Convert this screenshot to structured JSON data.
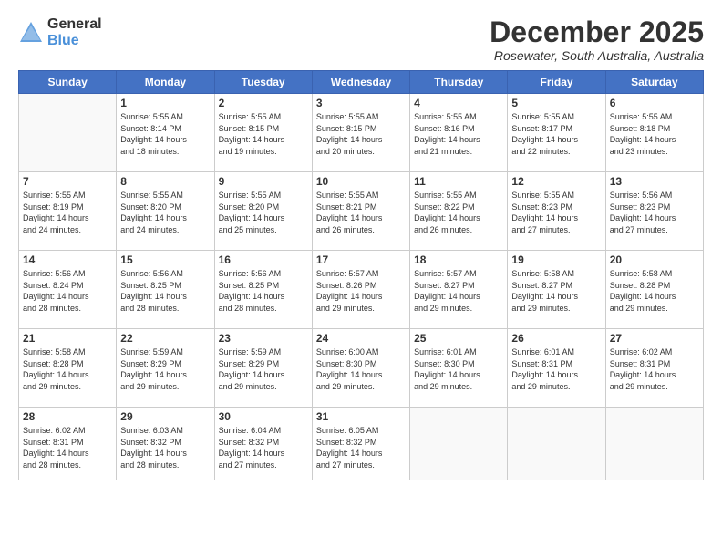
{
  "logo": {
    "general": "General",
    "blue": "Blue"
  },
  "title": "December 2025",
  "location": "Rosewater, South Australia, Australia",
  "days_of_week": [
    "Sunday",
    "Monday",
    "Tuesday",
    "Wednesday",
    "Thursday",
    "Friday",
    "Saturday"
  ],
  "weeks": [
    [
      {
        "day": "",
        "text": ""
      },
      {
        "day": "1",
        "text": "Sunrise: 5:55 AM\nSunset: 8:14 PM\nDaylight: 14 hours\nand 18 minutes."
      },
      {
        "day": "2",
        "text": "Sunrise: 5:55 AM\nSunset: 8:15 PM\nDaylight: 14 hours\nand 19 minutes."
      },
      {
        "day": "3",
        "text": "Sunrise: 5:55 AM\nSunset: 8:15 PM\nDaylight: 14 hours\nand 20 minutes."
      },
      {
        "day": "4",
        "text": "Sunrise: 5:55 AM\nSunset: 8:16 PM\nDaylight: 14 hours\nand 21 minutes."
      },
      {
        "day": "5",
        "text": "Sunrise: 5:55 AM\nSunset: 8:17 PM\nDaylight: 14 hours\nand 22 minutes."
      },
      {
        "day": "6",
        "text": "Sunrise: 5:55 AM\nSunset: 8:18 PM\nDaylight: 14 hours\nand 23 minutes."
      }
    ],
    [
      {
        "day": "7",
        "text": "Sunrise: 5:55 AM\nSunset: 8:19 PM\nDaylight: 14 hours\nand 24 minutes."
      },
      {
        "day": "8",
        "text": "Sunrise: 5:55 AM\nSunset: 8:20 PM\nDaylight: 14 hours\nand 24 minutes."
      },
      {
        "day": "9",
        "text": "Sunrise: 5:55 AM\nSunset: 8:20 PM\nDaylight: 14 hours\nand 25 minutes."
      },
      {
        "day": "10",
        "text": "Sunrise: 5:55 AM\nSunset: 8:21 PM\nDaylight: 14 hours\nand 26 minutes."
      },
      {
        "day": "11",
        "text": "Sunrise: 5:55 AM\nSunset: 8:22 PM\nDaylight: 14 hours\nand 26 minutes."
      },
      {
        "day": "12",
        "text": "Sunrise: 5:55 AM\nSunset: 8:23 PM\nDaylight: 14 hours\nand 27 minutes."
      },
      {
        "day": "13",
        "text": "Sunrise: 5:56 AM\nSunset: 8:23 PM\nDaylight: 14 hours\nand 27 minutes."
      }
    ],
    [
      {
        "day": "14",
        "text": "Sunrise: 5:56 AM\nSunset: 8:24 PM\nDaylight: 14 hours\nand 28 minutes."
      },
      {
        "day": "15",
        "text": "Sunrise: 5:56 AM\nSunset: 8:25 PM\nDaylight: 14 hours\nand 28 minutes."
      },
      {
        "day": "16",
        "text": "Sunrise: 5:56 AM\nSunset: 8:25 PM\nDaylight: 14 hours\nand 28 minutes."
      },
      {
        "day": "17",
        "text": "Sunrise: 5:57 AM\nSunset: 8:26 PM\nDaylight: 14 hours\nand 29 minutes."
      },
      {
        "day": "18",
        "text": "Sunrise: 5:57 AM\nSunset: 8:27 PM\nDaylight: 14 hours\nand 29 minutes."
      },
      {
        "day": "19",
        "text": "Sunrise: 5:58 AM\nSunset: 8:27 PM\nDaylight: 14 hours\nand 29 minutes."
      },
      {
        "day": "20",
        "text": "Sunrise: 5:58 AM\nSunset: 8:28 PM\nDaylight: 14 hours\nand 29 minutes."
      }
    ],
    [
      {
        "day": "21",
        "text": "Sunrise: 5:58 AM\nSunset: 8:28 PM\nDaylight: 14 hours\nand 29 minutes."
      },
      {
        "day": "22",
        "text": "Sunrise: 5:59 AM\nSunset: 8:29 PM\nDaylight: 14 hours\nand 29 minutes."
      },
      {
        "day": "23",
        "text": "Sunrise: 5:59 AM\nSunset: 8:29 PM\nDaylight: 14 hours\nand 29 minutes."
      },
      {
        "day": "24",
        "text": "Sunrise: 6:00 AM\nSunset: 8:30 PM\nDaylight: 14 hours\nand 29 minutes."
      },
      {
        "day": "25",
        "text": "Sunrise: 6:01 AM\nSunset: 8:30 PM\nDaylight: 14 hours\nand 29 minutes."
      },
      {
        "day": "26",
        "text": "Sunrise: 6:01 AM\nSunset: 8:31 PM\nDaylight: 14 hours\nand 29 minutes."
      },
      {
        "day": "27",
        "text": "Sunrise: 6:02 AM\nSunset: 8:31 PM\nDaylight: 14 hours\nand 29 minutes."
      }
    ],
    [
      {
        "day": "28",
        "text": "Sunrise: 6:02 AM\nSunset: 8:31 PM\nDaylight: 14 hours\nand 28 minutes."
      },
      {
        "day": "29",
        "text": "Sunrise: 6:03 AM\nSunset: 8:32 PM\nDaylight: 14 hours\nand 28 minutes."
      },
      {
        "day": "30",
        "text": "Sunrise: 6:04 AM\nSunset: 8:32 PM\nDaylight: 14 hours\nand 27 minutes."
      },
      {
        "day": "31",
        "text": "Sunrise: 6:05 AM\nSunset: 8:32 PM\nDaylight: 14 hours\nand 27 minutes."
      },
      {
        "day": "",
        "text": ""
      },
      {
        "day": "",
        "text": ""
      },
      {
        "day": "",
        "text": ""
      }
    ]
  ]
}
